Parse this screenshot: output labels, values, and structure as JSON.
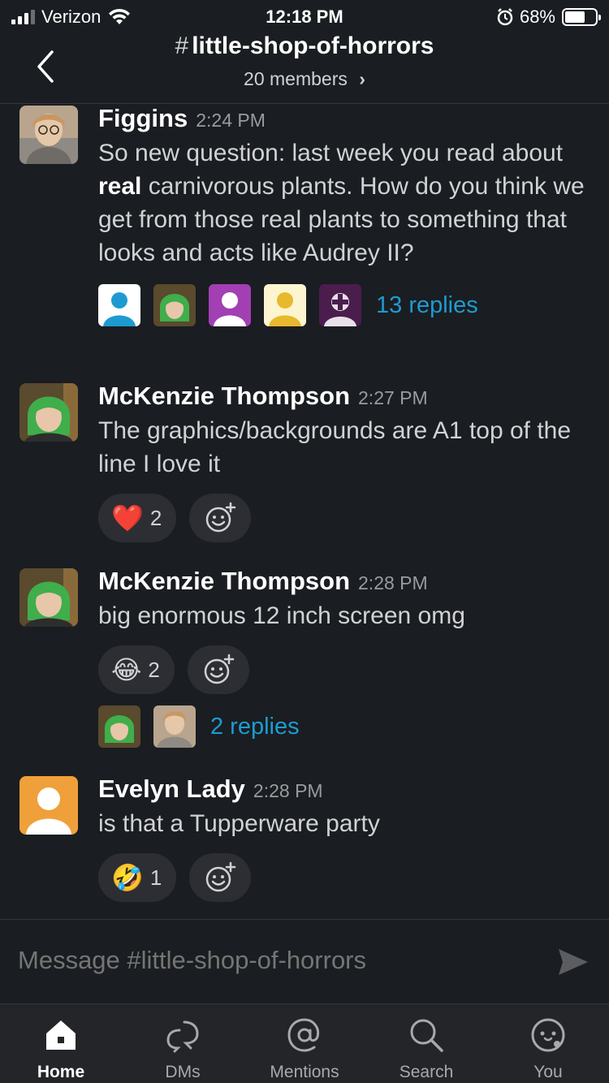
{
  "status_bar": {
    "carrier": "Verizon",
    "time": "12:18 PM",
    "battery": "68%"
  },
  "header": {
    "hash": "#",
    "channel": "little-shop-of-horrors",
    "members": "20 members",
    "members_chevron": "›"
  },
  "messages": [
    {
      "author": "Figgins",
      "time": "2:24 PM",
      "text_before": "So new question: last week you read about ",
      "text_bold": "real",
      "text_after": " carnivorous plants. How do you think we get from those real plants to something that looks and acts like Audrey II?",
      "replies": "13 replies"
    },
    {
      "author": "McKenzie Thompson",
      "time": "2:27 PM",
      "text": "The graphics/backgrounds are A1 top of the line I love it",
      "reaction_emoji": "❤️",
      "reaction_count": "2"
    },
    {
      "author": "McKenzie Thompson",
      "time": "2:28 PM",
      "text": "big enormous 12 inch screen omg",
      "reaction_emoji": "😂",
      "reaction_count": "2",
      "replies": "2 replies"
    },
    {
      "author": "Evelyn Lady",
      "time": "2:28 PM",
      "text": "is that a Tupperware party",
      "reaction_emoji": "🤣",
      "reaction_count": "1"
    }
  ],
  "composer": {
    "placeholder": "Message #little-shop-of-horrors"
  },
  "tabs": [
    {
      "label": "Home",
      "icon": "home-icon",
      "active": true
    },
    {
      "label": "DMs",
      "icon": "dms-icon",
      "active": false
    },
    {
      "label": "Mentions",
      "icon": "at-icon",
      "active": false
    },
    {
      "label": "Search",
      "icon": "search-icon",
      "active": false
    },
    {
      "label": "You",
      "icon": "smiley-icon",
      "active": false
    }
  ],
  "colors": {
    "background": "#1a1d21",
    "link": "#1d9bd1",
    "reaction_bg": "#2c2e33"
  }
}
